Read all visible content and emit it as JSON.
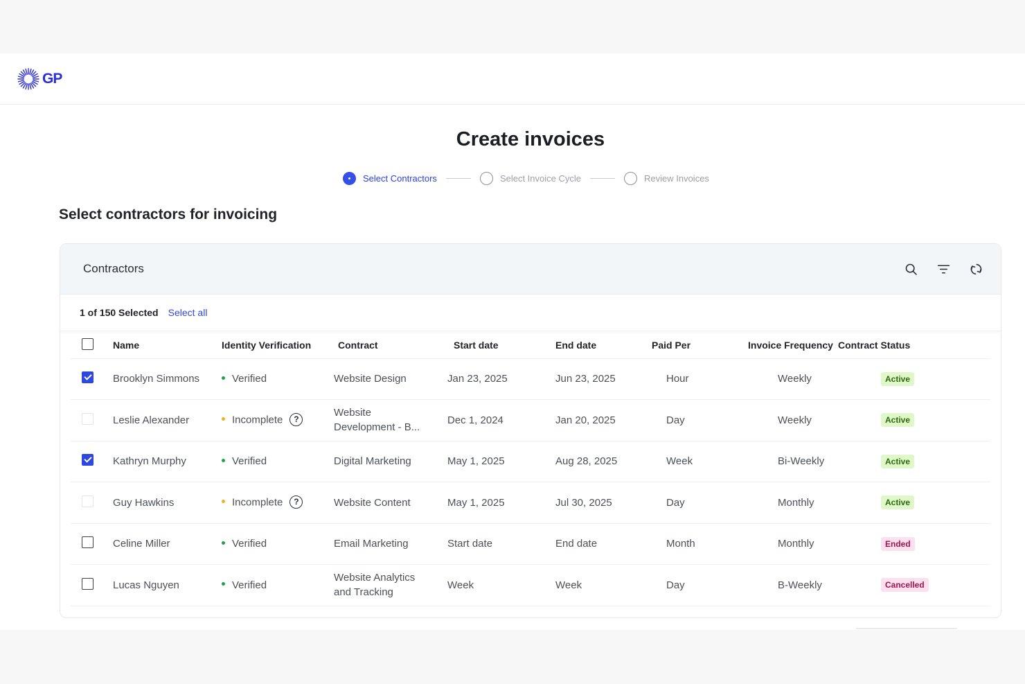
{
  "brand": {
    "logo_text": "GP"
  },
  "page": {
    "title": "Create invoices",
    "section_title": "Select contractors for invoicing"
  },
  "stepper": [
    {
      "label": "Select Contractors",
      "state": "active"
    },
    {
      "label": "Select Invoice Cycle",
      "state": "inactive"
    },
    {
      "label": "Review Invoices",
      "state": "inactive"
    }
  ],
  "card": {
    "title": "Contractors",
    "actions": [
      "search-icon",
      "filter-icon",
      "refresh-icon"
    ],
    "selection": {
      "count_text": "1 of 150 Selected",
      "select_all_label": "Select all"
    }
  },
  "table": {
    "columns": [
      "Name",
      "Identity Verification",
      "Contract",
      "Start date",
      "End date",
      "Paid Per",
      "Invoice Frequency",
      "Contract Status"
    ],
    "rows": [
      {
        "checkbox": "checked",
        "name": "Brooklyn Simmons",
        "verification": "Verified",
        "verification_status": "green",
        "contract": "Website Design",
        "start": "Jan 23, 2025",
        "end": "Jun 23, 2025",
        "paid_per": "Hour",
        "frequency": "Weekly",
        "status": "Active"
      },
      {
        "checkbox": "disabled",
        "name": "Leslie Alexander",
        "verification": "Incomplete",
        "verification_status": "amber",
        "contract": "Website Development - B...",
        "start": "Dec 1, 2024",
        "end": "Jan 20, 2025",
        "paid_per": "Day",
        "frequency": "Weekly",
        "status": "Active"
      },
      {
        "checkbox": "checked",
        "name": "Kathryn Murphy",
        "verification": "Verified",
        "verification_status": "green",
        "contract": "Digital Marketing",
        "start": "May 1, 2025",
        "end": "Aug 28, 2025",
        "paid_per": "Week",
        "frequency": "Bi-Weekly",
        "status": "Active"
      },
      {
        "checkbox": "disabled",
        "name": "Guy Hawkins",
        "verification": "Incomplete",
        "verification_status": "amber",
        "contract": "Website Content",
        "start": "May 1, 2025",
        "end": "Jul 30, 2025",
        "paid_per": "Day",
        "frequency": "Monthly",
        "status": "Active"
      },
      {
        "checkbox": "unchecked",
        "name": "Celine Miller",
        "verification": "Verified",
        "verification_status": "green",
        "contract": "Email Marketing",
        "start": "Start date",
        "end": "End date",
        "paid_per": "Month",
        "frequency": "Monthly",
        "status": "Ended"
      },
      {
        "checkbox": "unchecked",
        "name": "Lucas Nguyen",
        "verification": "Verified",
        "verification_status": "green",
        "contract": "Website Analytics and Tracking",
        "start": "Week",
        "end": "Week",
        "paid_per": "Day",
        "frequency": "B-Weekly",
        "status": "Cancelled"
      }
    ]
  },
  "colors": {
    "accent": "#3450e6",
    "link": "#2f47e0",
    "verified": "#22a047",
    "incomplete": "#f2b21e",
    "active_badge_bg": "#dff7c9",
    "ended_badge_bg": "#fde0ee"
  }
}
